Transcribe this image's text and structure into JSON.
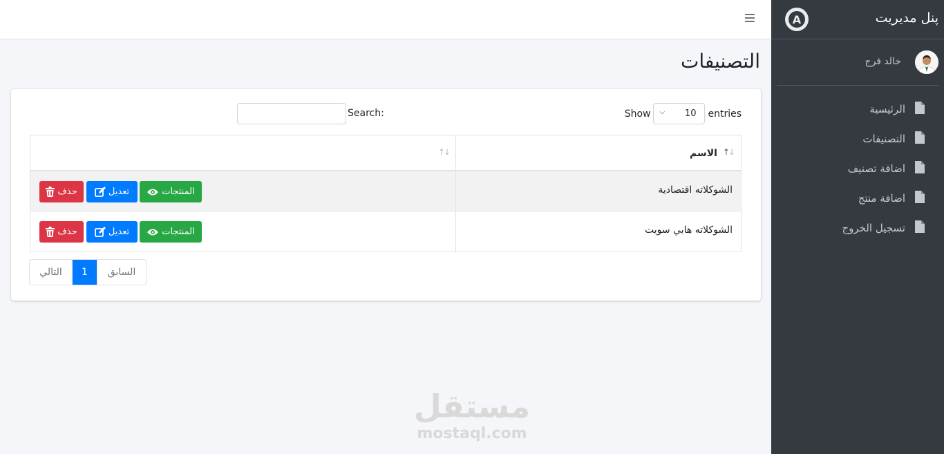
{
  "sidebar": {
    "brand": "پنل مديريت",
    "logo_letter": "A",
    "user_name": "خالد فرج",
    "items": [
      {
        "label": "الرئيسية",
        "icon": "file-icon"
      },
      {
        "label": "التصنيفات",
        "icon": "file-icon"
      },
      {
        "label": "اضافة تصنيف",
        "icon": "file-icon"
      },
      {
        "label": "اضافة منتج",
        "icon": "file-icon"
      },
      {
        "label": "تسجيل الخروج",
        "icon": "file-icon"
      }
    ]
  },
  "header": {
    "menu_icon": "hamburger-icon"
  },
  "page": {
    "title": "التصنيفات"
  },
  "table_controls": {
    "show_label": "Show",
    "entries_value": "10",
    "entries_label": "entries",
    "search_label": "Search:",
    "search_value": ""
  },
  "table": {
    "columns": [
      "الاسم",
      ""
    ],
    "rows": [
      {
        "name": "الشوكلاته اقتصادية"
      },
      {
        "name": "الشوكلاته هابي سويت"
      }
    ],
    "actions": {
      "products": "المنتجات",
      "edit": "تعديل",
      "delete": "حذف"
    }
  },
  "pagination": {
    "prev": "السابق",
    "current": "1",
    "next": "التالي"
  },
  "watermark": {
    "arabic": "مستقل",
    "latin": "mostaql.com"
  },
  "colors": {
    "sidebar": "#343a40",
    "success": "#28a745",
    "primary": "#007bff",
    "danger": "#dc3545"
  }
}
